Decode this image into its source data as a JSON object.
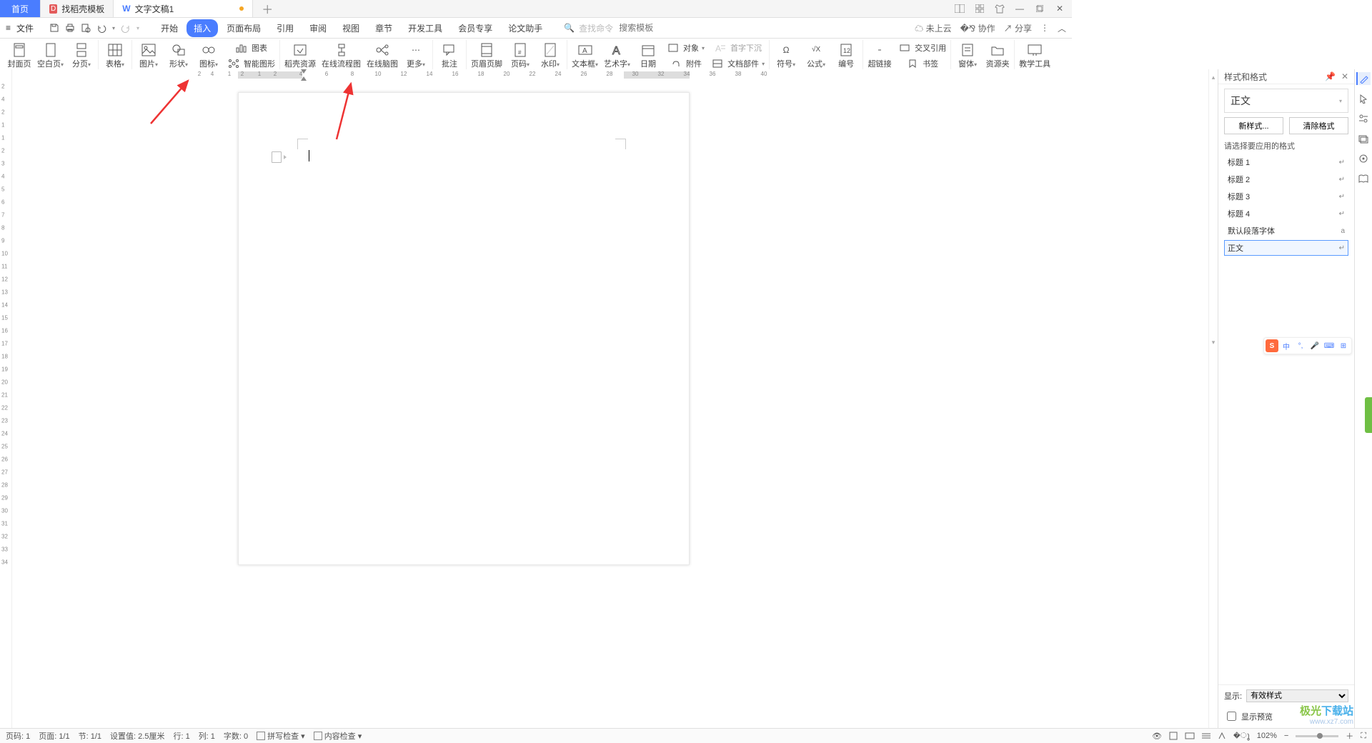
{
  "tabs": {
    "home": "首页",
    "template": "找稻壳模板",
    "doc": "文字文稿1"
  },
  "file_menu": "文件",
  "menutabs": [
    "开始",
    "插入",
    "页面布局",
    "引用",
    "审阅",
    "视图",
    "章节",
    "开发工具",
    "会员专享",
    "论文助手"
  ],
  "active_menu": 1,
  "search": {
    "cmd": "查找命令",
    "tpl": "搜索模板"
  },
  "topright": {
    "cloud": "未上云",
    "collab": "协作",
    "share": "分享"
  },
  "ribbon": {
    "cover": "封面页",
    "blank": "空白页",
    "page_break": "分页",
    "table": "表格",
    "picture": "图片",
    "shapes": "形状",
    "icons": "图标",
    "chart": "图表",
    "smart": "智能图形",
    "docer": "稻壳资源",
    "flow": "在线流程图",
    "mind": "在线脑图",
    "more": "更多",
    "comment": "批注",
    "hf": "页眉页脚",
    "pn": "页码",
    "wm": "水印",
    "textbox": "文本框",
    "wordart": "艺术字",
    "date": "日期",
    "obj": "对象",
    "attach": "附件",
    "dropcap": "首字下沉",
    "docparts": "文档部件",
    "symbol": "符号",
    "equation": "公式",
    "number": "编号",
    "link": "超链接",
    "bookmark": "书签",
    "xref": "交叉引用",
    "container": "窗体",
    "resource": "资源夹",
    "teach": "教学工具"
  },
  "sidepanel": {
    "title": "样式和格式",
    "current": "正文",
    "new": "新样式...",
    "clear": "清除格式",
    "choose": "请选择要应用的格式",
    "items": [
      "标题 1",
      "标题 2",
      "标题 3",
      "标题 4",
      "默认段落字体",
      "正文"
    ],
    "selected": 5,
    "show": "显示:",
    "show_val": "有效样式",
    "preview": "显示预览"
  },
  "status": {
    "pnum": "页码: 1",
    "page": "页面: 1/1",
    "sec": "节: 1/1",
    "set": "设置值: 2.5厘米",
    "row": "行: 1",
    "col": "列: 1",
    "words": "字数: 0",
    "spell": "拼写检查",
    "content": "内容检查",
    "zoom": "102%"
  },
  "floatbar": {
    "s": "S",
    "zh": "中"
  },
  "watermark": {
    "l1a": "极光",
    "l1b": "下载站",
    "l2": "www.xz7.com"
  },
  "hruler": [
    2,
    4,
    1,
    2,
    1,
    2,
    4,
    6,
    8,
    10,
    12,
    14,
    16,
    18,
    20,
    22,
    24,
    26,
    28,
    30,
    32,
    34,
    36,
    38,
    40
  ],
  "vruler": [
    2,
    4,
    2,
    1,
    1,
    2,
    3,
    4,
    5,
    6,
    7,
    8,
    9,
    10,
    11,
    12,
    13,
    14,
    15,
    16,
    17,
    18,
    19,
    20,
    21,
    22,
    23,
    24,
    25,
    26,
    27,
    28,
    29,
    30,
    31,
    32,
    33,
    34
  ]
}
